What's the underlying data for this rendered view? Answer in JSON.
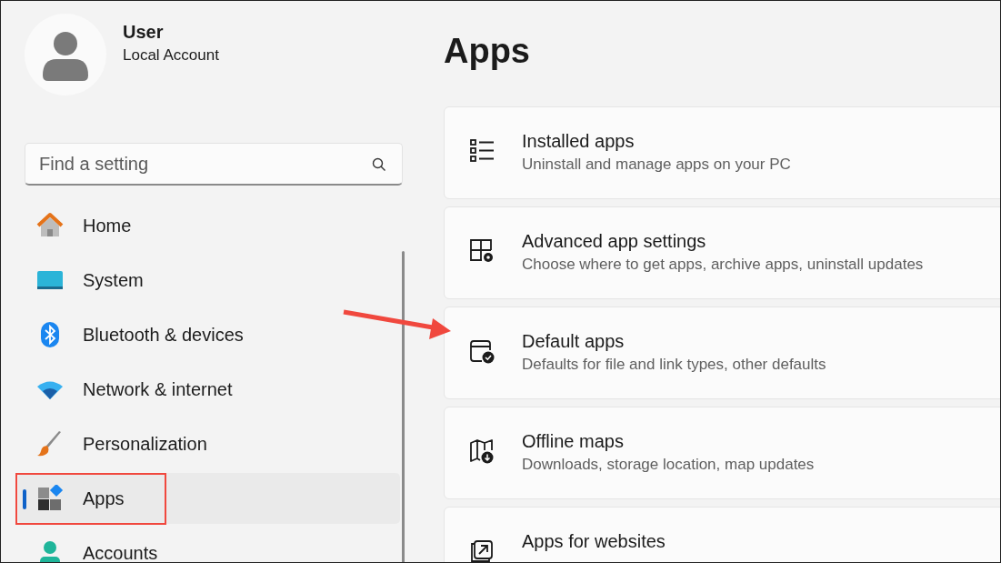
{
  "profile": {
    "name": "User",
    "account_type": "Local Account"
  },
  "search": {
    "placeholder": "Find a setting"
  },
  "nav_items": [
    {
      "label": "Home",
      "kind": "home",
      "selected": false
    },
    {
      "label": "System",
      "kind": "system",
      "selected": false
    },
    {
      "label": "Bluetooth & devices",
      "kind": "bluetooth",
      "selected": false
    },
    {
      "label": "Network & internet",
      "kind": "network",
      "selected": false
    },
    {
      "label": "Personalization",
      "kind": "personalization",
      "selected": false
    },
    {
      "label": "Apps",
      "kind": "apps",
      "selected": true
    },
    {
      "label": "Accounts",
      "kind": "accounts",
      "selected": false
    }
  ],
  "page_title": "Apps",
  "cards": [
    {
      "title": "Installed apps",
      "description": "Uninstall and manage apps on your PC",
      "kind": "list"
    },
    {
      "title": "Advanced app settings",
      "description": "Choose where to get apps, archive apps, uninstall updates",
      "kind": "advanced"
    },
    {
      "title": "Default apps",
      "description": "Defaults for file and link types, other defaults",
      "kind": "default"
    },
    {
      "title": "Offline maps",
      "description": "Downloads, storage location, map updates",
      "kind": "maps"
    },
    {
      "title": "Apps for websites",
      "kind": "websites"
    }
  ],
  "annotations": {
    "highlight_box": true,
    "arrow": true
  }
}
